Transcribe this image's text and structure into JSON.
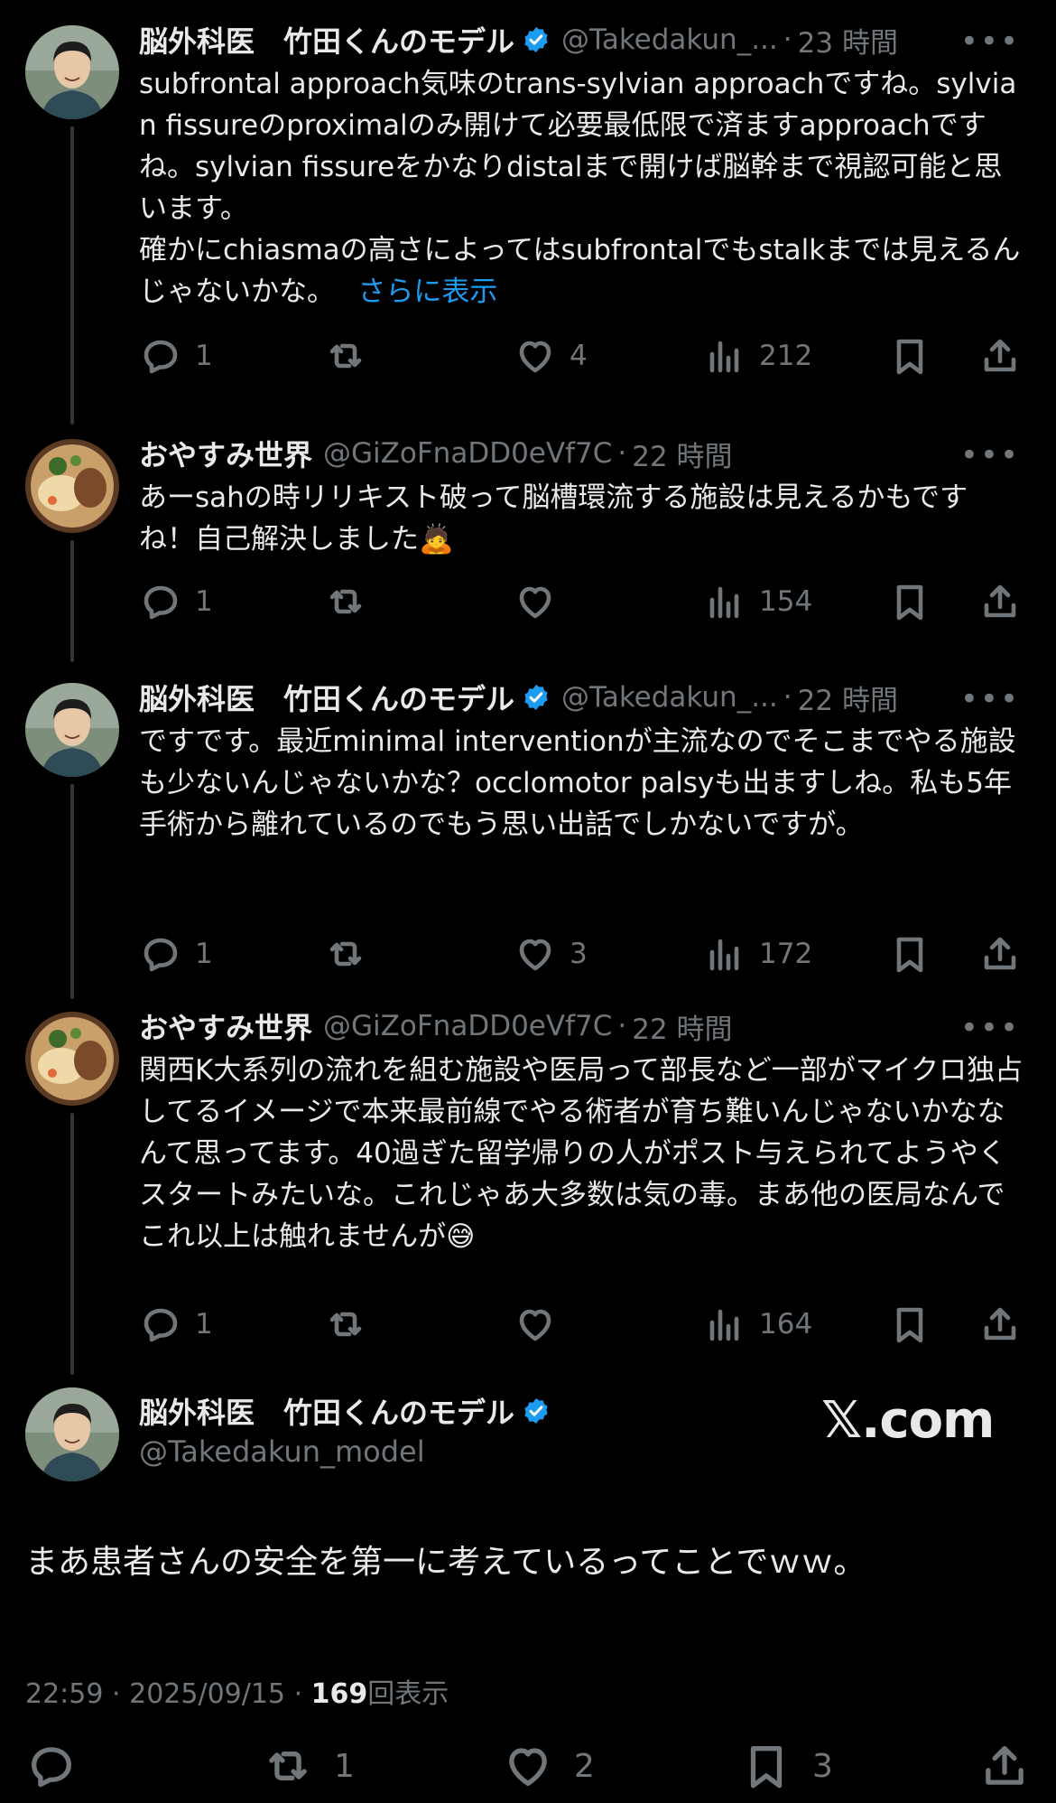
{
  "colors": {
    "background": "#000000",
    "text": "#e7e9ea",
    "muted": "#71767b",
    "link": "#1d9bf0",
    "verified": "#1d9bf0"
  },
  "tweets": [
    {
      "name": "脳外科医　竹田くんのモデル",
      "handle": "@Takedakun_...",
      "time": "23 時間",
      "text": "subfrontal approach気味のtrans-sylvian approachですね。sylvian fissureのproximalのみ開けて必要最低限で済ますapproachですね。sylvian fissureをかなりdistalまで開けば脳幹まで視認可能と思います。\n確かにchiasmaの高さによってはsubfrontalでもstalkまでは見えるんじゃないかな。",
      "show_more": "さらに表示",
      "replies": "1",
      "retweets": "",
      "likes": "4",
      "views": "212",
      "avatar": "doctor-avatar",
      "verified": true
    },
    {
      "name": "おやすみ世界",
      "handle": "@GiZoFnaDD0eVf7C",
      "time": "22 時間",
      "text": "あーsahの時リリキスト破って脳槽環流する施設は見えるかもですね！自己解決しました🙇",
      "replies": "1",
      "retweets": "",
      "likes": "",
      "views": "154",
      "avatar": "food-avatar",
      "verified": false
    },
    {
      "name": "脳外科医　竹田くんのモデル",
      "handle": "@Takedakun_...",
      "time": "22 時間",
      "text": "ですです。最近minimal interventionが主流なのでそこまでやる施設も少ないんじゃないかな？occlomotor palsyも出ますしね。私も5年手術から離れているのでもう思い出話でしかないですが。",
      "replies": "1",
      "retweets": "",
      "likes": "3",
      "views": "172",
      "avatar": "doctor-avatar",
      "verified": true
    },
    {
      "name": "おやすみ世界",
      "handle": "@GiZoFnaDD0eVf7C",
      "time": "22 時間",
      "text": "関西K大系列の流れを組む施設や医局って部長など一部がマイクロ独占してるイメージで本来最前線でやる術者が育ち難いんじゃないかななんて思ってます。40過ぎた留学帰りの人がポスト与えられてようやくスタートみたいな。これじゃあ大多数は気の毒。まあ他の医局なんでこれ以上は触れませんが😅",
      "replies": "1",
      "retweets": "",
      "likes": "",
      "views": "164",
      "avatar": "food-avatar",
      "verified": false
    }
  ],
  "main": {
    "name": "脳外科医　竹田くんのモデル",
    "handle": "@Takedakun_model",
    "watermark": "𝕏.com",
    "text": "まあ患者さんの安全を第一に考えているってことでｗｗ。",
    "time": "22:59",
    "date": "2025/09/15",
    "view_count": "169",
    "view_label": "回表示",
    "retweets": "1",
    "likes": "2",
    "bookmarks": "3"
  },
  "separator": "·"
}
